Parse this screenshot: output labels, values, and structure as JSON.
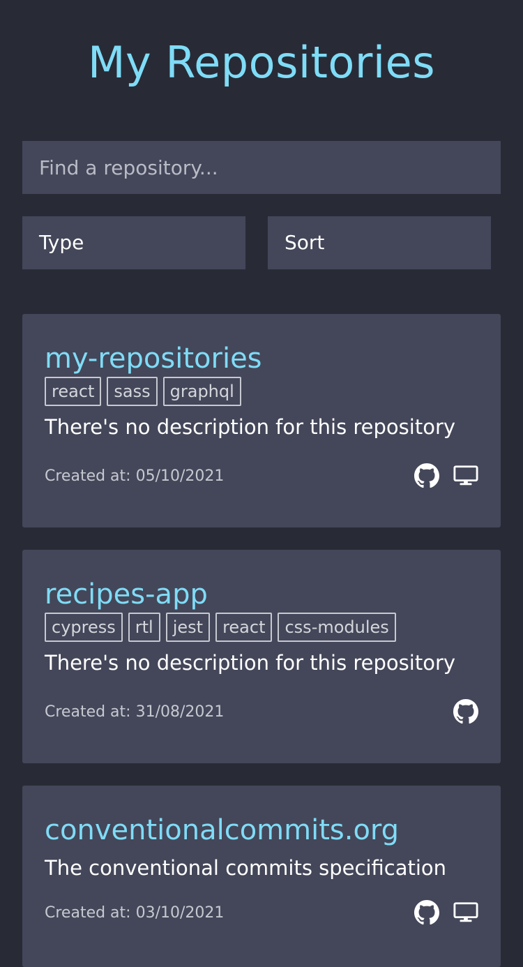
{
  "header": {
    "title": "My Repositories"
  },
  "search": {
    "placeholder": "Find a repository..."
  },
  "filters": {
    "type_label": "Type",
    "sort_label": "Sort"
  },
  "colors": {
    "background": "#282b36",
    "card": "#444759",
    "accent": "#7fdcf7"
  },
  "repositories": [
    {
      "name": "my-repositories",
      "tags": [
        "react",
        "sass",
        "graphql"
      ],
      "description": "There's no description for this repository",
      "created": "Created at: 05/10/2021",
      "icons": [
        "github-icon",
        "desktop-icon"
      ]
    },
    {
      "name": "recipes-app",
      "tags": [
        "cypress",
        "rtl",
        "jest",
        "react",
        "css-modules"
      ],
      "description": "There's no description for this repository",
      "created": "Created at: 31/08/2021",
      "icons": [
        "github-icon"
      ]
    },
    {
      "name": "conventionalcommits.org",
      "tags": [],
      "description": "The conventional commits specification",
      "created": "Created at: 03/10/2021",
      "icons": [
        "github-icon",
        "desktop-icon"
      ]
    }
  ]
}
